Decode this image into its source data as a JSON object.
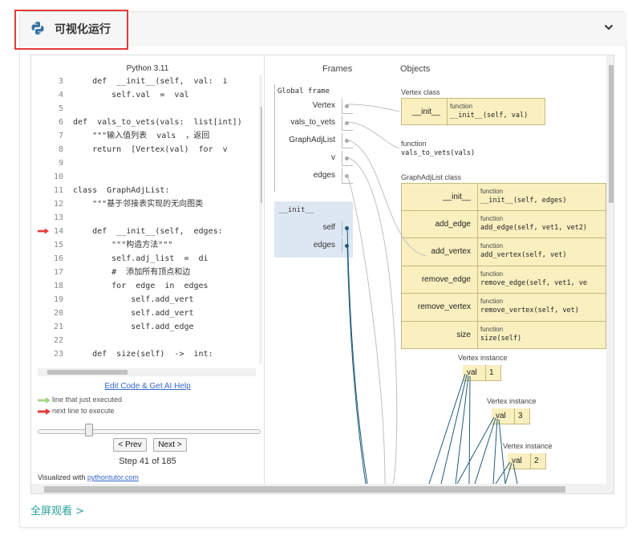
{
  "card": {
    "title": "可视化运行",
    "icon": "python-logo-icon",
    "expand_icon": "chevron-down-icon"
  },
  "code": {
    "python_version": "Python 3.11",
    "lines": [
      {
        "num": "3",
        "text": "    def  __init__(self,  val:  i"
      },
      {
        "num": "4",
        "text": "        self.val  =  val"
      },
      {
        "num": "5",
        "text": ""
      },
      {
        "num": "6",
        "text": "def  vals_to_vets(vals:  list[int])"
      },
      {
        "num": "7",
        "text": "    \"\"\"输入值列表  vals  ，返回"
      },
      {
        "num": "8",
        "text": "    return  [Vertex(val)  for  v"
      },
      {
        "num": "9",
        "text": ""
      },
      {
        "num": "10",
        "text": ""
      },
      {
        "num": "11",
        "text": "class  GraphAdjList:"
      },
      {
        "num": "12",
        "text": "    \"\"\"基于邻接表实现的无向图类"
      },
      {
        "num": "13",
        "text": ""
      },
      {
        "num": "14",
        "text": "    def  __init__(self,  edges:"
      },
      {
        "num": "15",
        "text": "        \"\"\"构造方法\"\"\""
      },
      {
        "num": "16",
        "text": "        self.adj_list  =  di"
      },
      {
        "num": "17",
        "text": "        #  添加所有顶点和边"
      },
      {
        "num": "18",
        "text": "        for  edge  in  edges"
      },
      {
        "num": "19",
        "text": "            self.add_vert"
      },
      {
        "num": "20",
        "text": "            self.add_vert"
      },
      {
        "num": "21",
        "text": "            self.add_edge"
      },
      {
        "num": "22",
        "text": ""
      },
      {
        "num": "23",
        "text": "    def  size(self)  ->  int:"
      }
    ],
    "next_line_index": 11,
    "edit_link": "Edit Code & Get AI Help",
    "legend_executed": "line that just executed",
    "legend_next": "next line to execute",
    "legend_executed_color": "#a6d68a",
    "legend_next_color": "#e43a3a",
    "prev_label": "< Prev",
    "next_label": "Next >",
    "step_text": "Step 41 of 185",
    "step_current": 41,
    "step_total": 185,
    "visualized_prefix": "Visualized with",
    "visualized_link": "pythontutor.com"
  },
  "frames": {
    "header": "Frames",
    "global_title": "Global frame",
    "global_vars": [
      "Vertex",
      "vals_to_vets",
      "GraphAdjList",
      "v",
      "edges"
    ],
    "init_title": "__init__",
    "init_vars": [
      "self",
      "edges"
    ]
  },
  "objects": {
    "header": "Objects",
    "vertex_class_title": "Vertex class",
    "vertex_class_rows": [
      {
        "key": "__init__",
        "tag": "function",
        "sig": "__init__(self,  val)"
      }
    ],
    "func_title": "function",
    "func_sig": "vals_to_vets(vals)",
    "graph_class_title": "GraphAdjList class",
    "graph_class_rows": [
      {
        "key": "__init__",
        "tag": "function",
        "sig": "__init__(self,  edges)"
      },
      {
        "key": "add_edge",
        "tag": "function",
        "sig": "add_edge(self,  vet1,  vet2)"
      },
      {
        "key": "add_vertex",
        "tag": "function",
        "sig": "add_vertex(self,  vet)"
      },
      {
        "key": "remove_edge",
        "tag": "function",
        "sig": "remove_edge(self,  vet1,  ve"
      },
      {
        "key": "remove_vertex",
        "tag": "function",
        "sig": "remove_vertex(self,  vet)"
      },
      {
        "key": "size",
        "tag": "function",
        "sig": "size(self)"
      }
    ],
    "instances": [
      {
        "title": "Vertex instance",
        "key": "val",
        "value": "1"
      },
      {
        "title": "Vertex instance",
        "key": "val",
        "value": "3"
      },
      {
        "title": "Vertex instance",
        "key": "val",
        "value": "2"
      }
    ]
  },
  "footer": {
    "fullscreen": "全屏观看 >",
    "fullscreen_color": "#2aa198"
  }
}
